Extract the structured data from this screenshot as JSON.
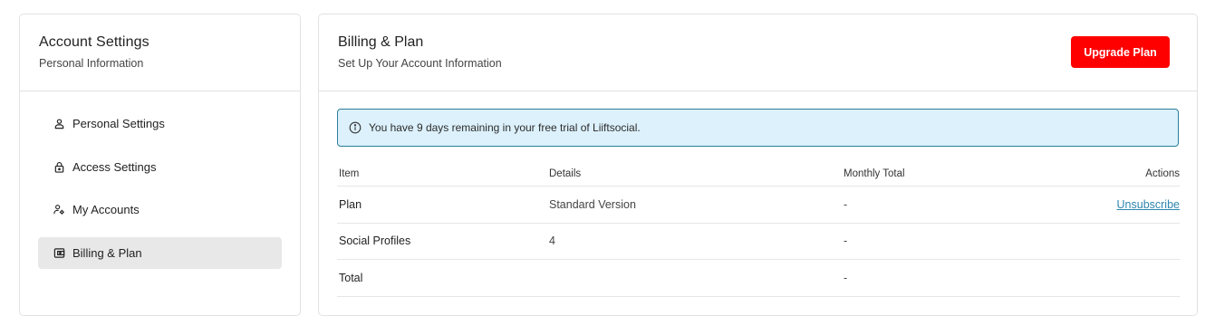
{
  "sidebar": {
    "title": "Account Settings",
    "subtitle": "Personal Information",
    "items": [
      {
        "label": "Personal Settings",
        "icon": "person-icon",
        "active": false
      },
      {
        "label": "Access Settings",
        "icon": "lock-icon",
        "active": false
      },
      {
        "label": "My Accounts",
        "icon": "user-settings-icon",
        "active": false
      },
      {
        "label": "Billing & Plan",
        "icon": "wallet-icon",
        "active": true
      }
    ]
  },
  "main": {
    "title": "Billing & Plan",
    "subtitle": "Set Up Your Account Information",
    "upgrade_label": "Upgrade Plan",
    "alert": "You have 9 days remaining in your free trial of Liiftsocial.",
    "table": {
      "headers": [
        "Item",
        "Details",
        "Monthly Total",
        "Actions"
      ],
      "rows": [
        {
          "item": "Plan",
          "details": "Standard Version",
          "monthly": "-",
          "action": "Unsubscribe"
        },
        {
          "item": "Social Profiles",
          "details": "4",
          "monthly": "-",
          "action": ""
        },
        {
          "item": "Total",
          "details": "",
          "monthly": "-",
          "action": ""
        }
      ]
    }
  },
  "colors": {
    "accent": "#fe0000",
    "alert_bg": "#dcf1fc",
    "alert_border": "#2a7d97",
    "link": "#2e86b0",
    "active_nav": "#e8e8e8"
  }
}
